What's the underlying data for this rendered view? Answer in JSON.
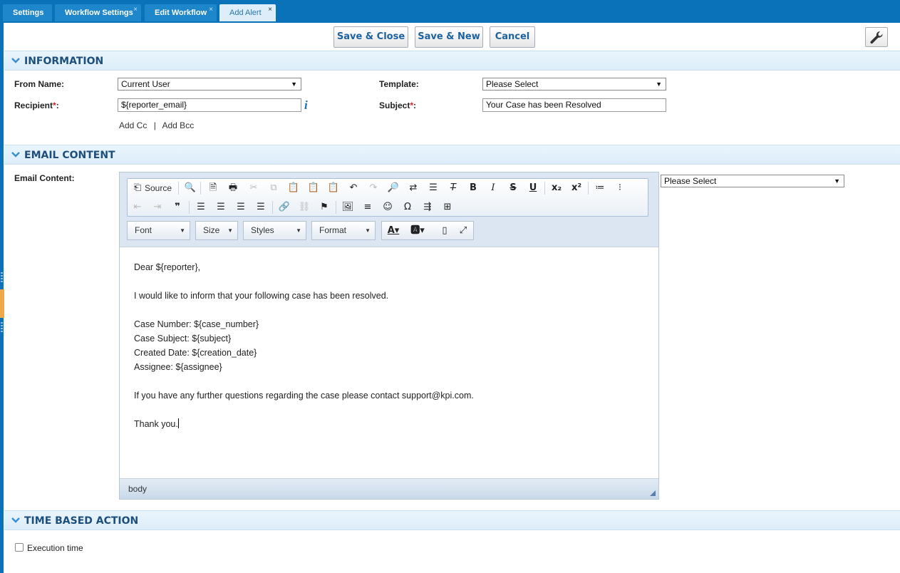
{
  "tabs": [
    {
      "label": "Settings",
      "closable": false
    },
    {
      "label": "Workflow Settings",
      "closable": true
    },
    {
      "label": "Edit Workflow",
      "closable": true
    },
    {
      "label": "Add Alert",
      "closable": true,
      "active": true
    }
  ],
  "tab_close_glyph": "×",
  "toolbar": {
    "save_close": "Save & Close",
    "save_new": "Save & New",
    "cancel": "Cancel",
    "wrench_icon": "wrench-icon"
  },
  "information": {
    "title": "INFORMATION",
    "from_name_label": "From Name:",
    "from_name_value": "Current User",
    "recipient_label": "Recipient",
    "recipient_value": "${reporter_email}",
    "template_label": "Template:",
    "template_value": "Please Select",
    "subject_label": "Subject",
    "subject_value": "Your Case has been Resolved",
    "add_cc": "Add Cc",
    "cc_separator": "|",
    "add_bcc": "Add Bcc",
    "required_mark": "*",
    "colon": ":",
    "info_glyph": "i"
  },
  "email_content": {
    "title": "EMAIL CONTENT",
    "label": "Email Content:",
    "placeholder_select": "Please Select",
    "source_label": "Source",
    "combos": [
      "Font",
      "Size",
      "Styles",
      "Format"
    ],
    "body_lines": [
      "Dear ${reporter},",
      "",
      "I would like to inform that your following case has been resolved.",
      "",
      "Case Number: ${case_number}",
      "Case Subject: ${subject}",
      "Created Date: ${creation_date}",
      "Assignee: ${assignee}",
      "",
      "If you have any further questions regarding the case please contact support@kpi.com.",
      "",
      "Thank you."
    ],
    "status_path": "body"
  },
  "time_based": {
    "title": "TIME BASED ACTION",
    "execution_label": "Execution time"
  },
  "colors": {
    "tabbar": "#0a72b9",
    "accent_text": "#1d4f7a",
    "required": "#dd2222"
  }
}
